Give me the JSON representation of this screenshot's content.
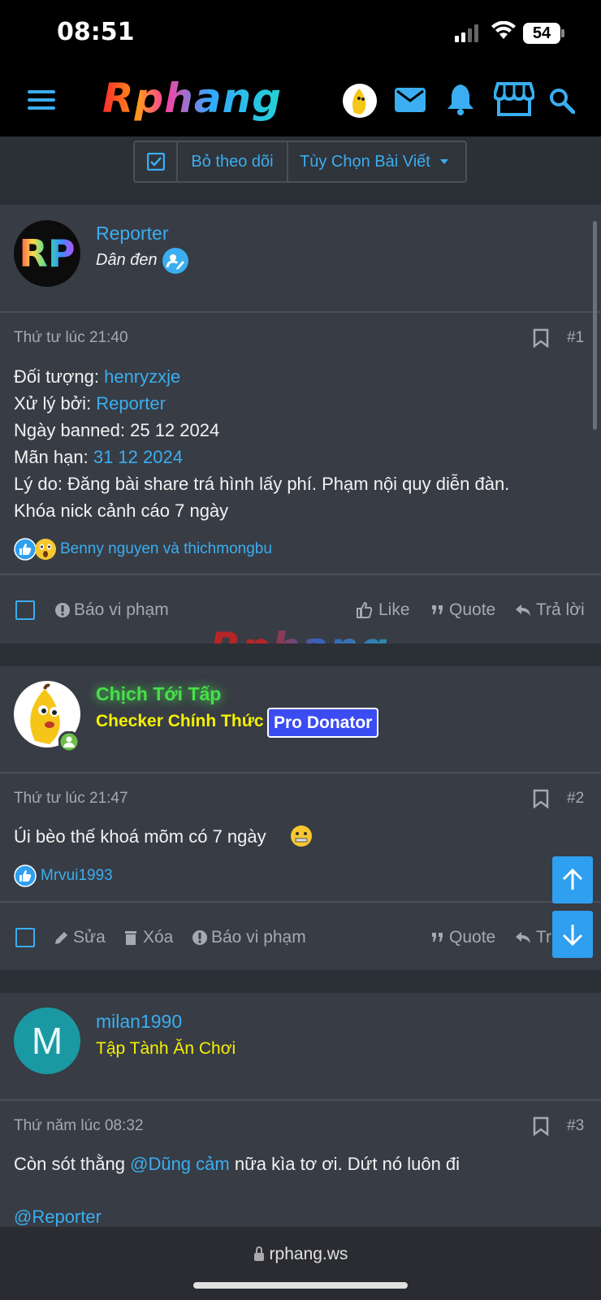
{
  "status_bar": {
    "time": "08:51",
    "battery": "54"
  },
  "header": {
    "logo_text": "Rphang"
  },
  "thread_controls": {
    "unfollow_label": "Bỏ theo dõi",
    "post_options_label": "Tùy Chọn Bài Viết"
  },
  "posts": [
    {
      "username": "Reporter",
      "user_title": "Dân đen",
      "avatar_text": "RP",
      "date": "Thứ tư lúc 21:40",
      "number": "#1",
      "lines": {
        "target_label": "Đối tượng: ",
        "target_value": "henryzxje",
        "handled_label": "Xử lý bởi: ",
        "handled_value": "Reporter",
        "banned_label": "Ngày banned: ",
        "banned_value": "25 12 2024",
        "expire_label": "Mãn hạn: ",
        "expire_value": "31 12 2024",
        "reason": "Lý do: Đăng bài share trá hình lấy phí. Phạm nội quy diễn đàn.",
        "penalty": "Khóa nick cảnh cáo 7 ngày"
      },
      "reactions_text": "Benny nguyen và thichmongbu",
      "actions": {
        "report": "Báo vi phạm",
        "like": "Like",
        "quote": "Quote",
        "reply": "Trả lời"
      }
    },
    {
      "username": "Chịch Tới Tấp",
      "user_title": "Checker Chính Thức",
      "badge": "Pro Donator",
      "date": "Thứ tư lúc 21:47",
      "number": "#2",
      "text": "Úi bèo thế khoá mõm có 7 ngày",
      "reactions_text": "Mrvui1993",
      "actions": {
        "edit": "Sửa",
        "delete": "Xóa",
        "report": "Báo vi phạm",
        "quote": "Quote",
        "reply": "Tr"
      }
    },
    {
      "username": "milan1990",
      "user_title": "Tập Tành Ăn Chơi",
      "avatar_letter": "M",
      "date": "Thứ năm lúc 08:32",
      "number": "#3",
      "text_before": "Còn sót thằng ",
      "mention1": "@Dũng cảm",
      "text_after": " nữa kìa tơ ơi. Dứt nó luôn đi",
      "mention2": "@Reporter"
    }
  ],
  "watermark": "Rphang",
  "browser": {
    "url": "rphang.ws"
  },
  "colors": {
    "accent": "#3aaef0",
    "post_bg": "#383c45",
    "page_bg": "#2b2f36",
    "green_name": "#47e04a",
    "yellow_title": "#f4f100",
    "badge_blue": "#3b4cf2"
  },
  "icons": [
    "hamburger-icon",
    "mail-icon",
    "bell-icon",
    "store-icon",
    "search-icon",
    "bookmark-icon",
    "like-icon",
    "quote-icon",
    "reply-icon",
    "report-icon",
    "edit-icon",
    "trash-icon",
    "arrow-up-icon",
    "arrow-down-icon",
    "lock-icon"
  ]
}
